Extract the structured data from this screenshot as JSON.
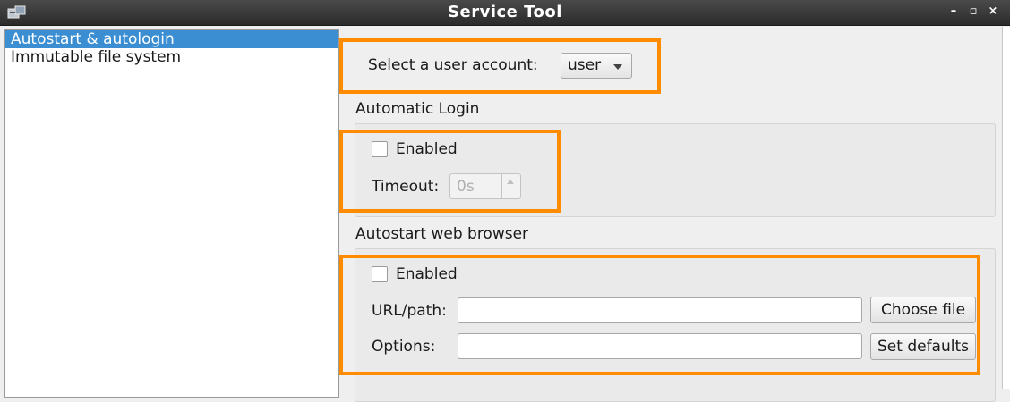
{
  "window": {
    "title": "Service Tool",
    "minimize_label": "–",
    "maximize_label": "▫",
    "close_label": "×"
  },
  "sidebar": {
    "items": [
      {
        "label": "Autostart & autologin",
        "selected": true
      },
      {
        "label": "Immutable file system",
        "selected": false
      }
    ]
  },
  "user_account": {
    "label": "Select a user account:",
    "value": "user"
  },
  "automatic_login": {
    "heading": "Automatic Login",
    "enabled_label": "Enabled",
    "enabled": false,
    "timeout_label": "Timeout:",
    "timeout_value": "0s"
  },
  "autostart_browser": {
    "heading": "Autostart web browser",
    "enabled_label": "Enabled",
    "enabled": false,
    "url_label": "URL/path:",
    "url_value": "",
    "choose_file_label": "Choose file",
    "options_label": "Options:",
    "options_value": "",
    "set_defaults_label": "Set defaults"
  },
  "colors": {
    "highlight": "#ff8c00",
    "selection": "#3b8ed2",
    "titlebar": "#2b2b2b"
  }
}
